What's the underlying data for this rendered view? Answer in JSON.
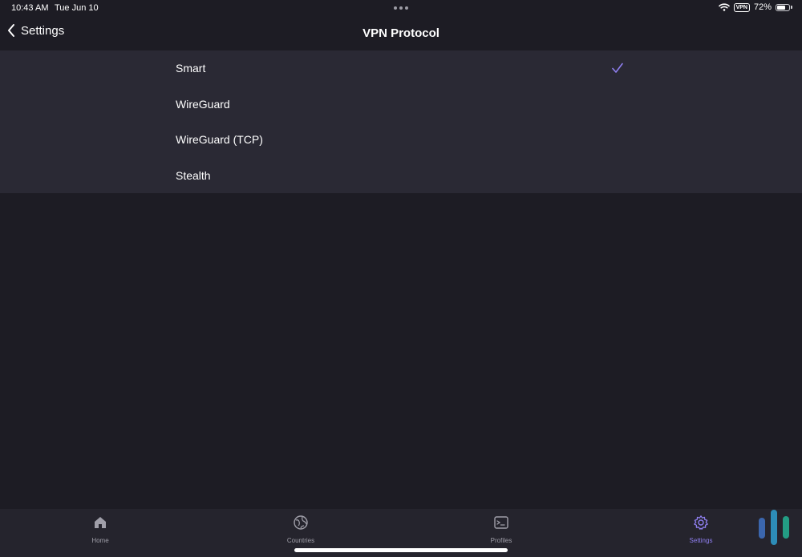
{
  "status_bar": {
    "time": "10:43 AM",
    "date": "Tue Jun 10",
    "vpn_badge": "VPN",
    "battery_percent_text": "72%",
    "battery_level": 0.72
  },
  "nav": {
    "back_label": "Settings",
    "title": "VPN Protocol"
  },
  "protocols": [
    {
      "label": "Smart",
      "selected": true
    },
    {
      "label": "WireGuard",
      "selected": false
    },
    {
      "label": "WireGuard (TCP)",
      "selected": false
    },
    {
      "label": "Stealth",
      "selected": false
    }
  ],
  "tabs": [
    {
      "label": "Home",
      "icon": "home-icon",
      "active": false
    },
    {
      "label": "Countries",
      "icon": "globe-icon",
      "active": false
    },
    {
      "label": "Profiles",
      "icon": "profiles-icon",
      "active": false
    },
    {
      "label": "Settings",
      "icon": "gear-icon",
      "active": true
    }
  ],
  "colors": {
    "background": "#1d1c24",
    "list_background": "#2a2934",
    "tab_bar_background": "#25242d",
    "accent": "#8f7ff0",
    "inactive": "#a09fa9"
  }
}
